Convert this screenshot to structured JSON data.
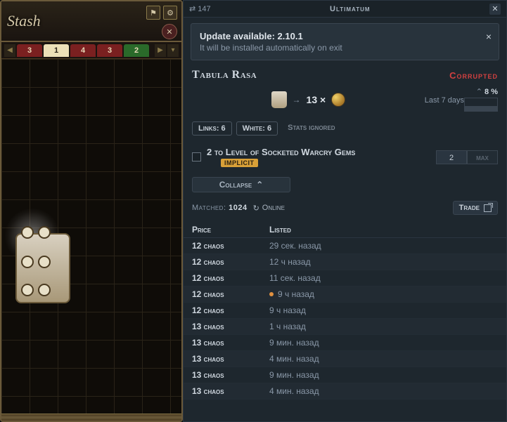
{
  "stash": {
    "title": "Stash",
    "tabs": [
      "3",
      "1",
      "4",
      "3",
      "2"
    ],
    "active_index": 1
  },
  "titlebar": {
    "ping": "147",
    "league": "Ultimatum"
  },
  "update": {
    "title": "Update available: 2.10.1",
    "body": "It will be installed automatically on exit"
  },
  "item": {
    "name": "Tabula Rasa",
    "corrupted": "Corrupted",
    "price_qty": "13 ×",
    "trend_pct": "8 %",
    "trend_label": "Last 7 days"
  },
  "pills": {
    "links": "Links: 6",
    "white": "White: 6",
    "stats": "Stats ignored"
  },
  "mod": {
    "text": "2 to Level of Socketed Warcry Gems",
    "badge": "IMPLICIT",
    "value": "2",
    "max": "max"
  },
  "collapse": "Collapse",
  "match": {
    "label": "Matched:",
    "count": "1024",
    "online": "Online",
    "trade": "Trade"
  },
  "columns": {
    "price": "Price",
    "listed": "Listed"
  },
  "rows": [
    {
      "price": "12 chaos",
      "listed": "29 сек. назад",
      "dot": false
    },
    {
      "price": "12 chaos",
      "listed": "12 ч назад",
      "dot": false
    },
    {
      "price": "12 chaos",
      "listed": "11 сек. назад",
      "dot": false
    },
    {
      "price": "12 chaos",
      "listed": "9 ч назад",
      "dot": true
    },
    {
      "price": "12 chaos",
      "listed": "9 ч назад",
      "dot": false
    },
    {
      "price": "13 chaos",
      "listed": "1 ч назад",
      "dot": false
    },
    {
      "price": "13 chaos",
      "listed": "9 мин. назад",
      "dot": false
    },
    {
      "price": "13 chaos",
      "listed": "4 мин. назад",
      "dot": false
    },
    {
      "price": "13 chaos",
      "listed": "9 мин. назад",
      "dot": false
    },
    {
      "price": "13 chaos",
      "listed": "4 мин. назад",
      "dot": false
    }
  ]
}
